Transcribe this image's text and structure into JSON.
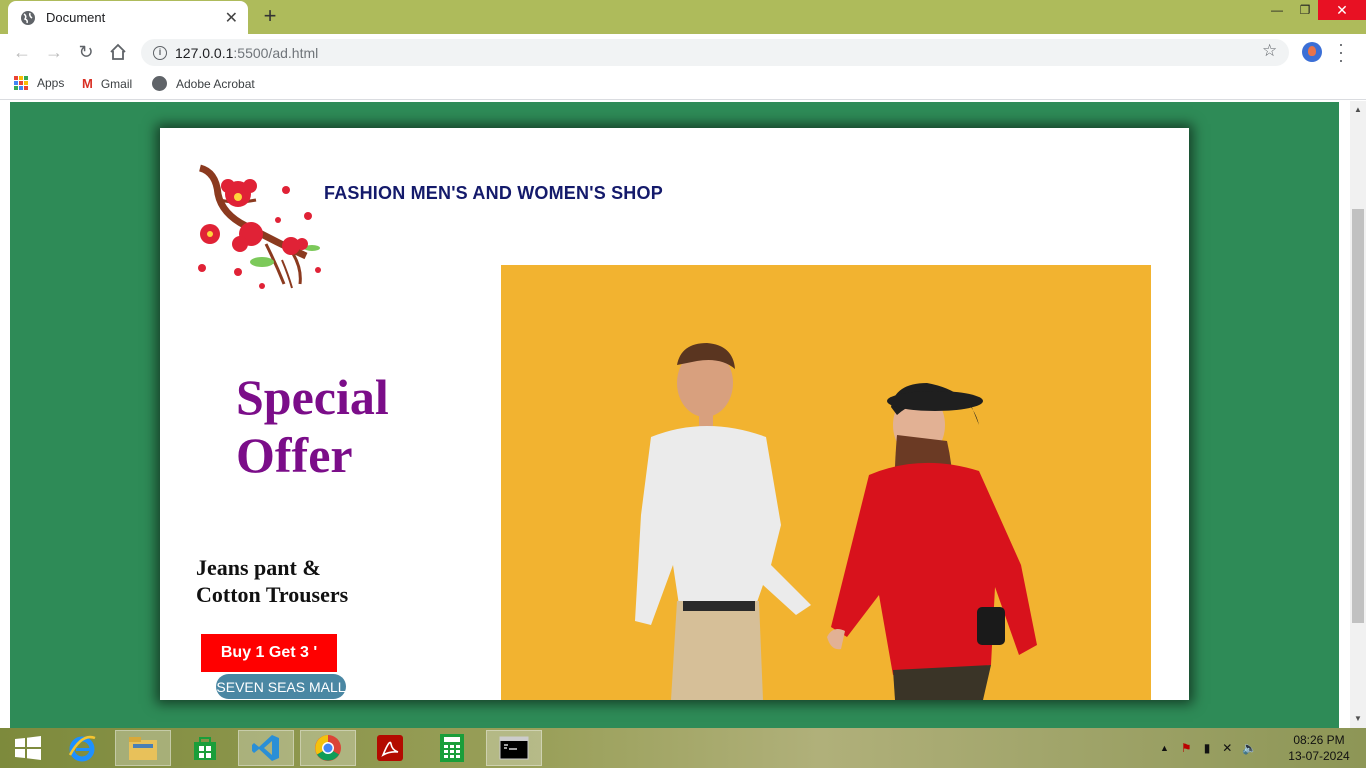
{
  "browser": {
    "tab_title": "Document",
    "url_host": "127.0.0.1",
    "url_path": ":5500/ad.html",
    "bookmarks": [
      {
        "label": "Apps"
      },
      {
        "label": "Gmail"
      },
      {
        "label": "Adobe Acrobat"
      }
    ]
  },
  "ad": {
    "shop_title": "FASHION MEN'S AND WOMEN'S SHOP",
    "offer_line1": "Special",
    "offer_line2": "Offer",
    "product_line1": "Jeans pant &",
    "product_line2": "Cotton Trousers",
    "buy_button": "Buy 1 Get 3 '",
    "mall_button": "SEVEN SEAS MALL",
    "colors": {
      "page_background": "#2e8b57",
      "title": "#141a6b",
      "offer": "#7b0d89",
      "buy_button": "#ff0000",
      "mall_button": "#4a87a3",
      "photo_background": "#f0b02c"
    }
  },
  "taskbar": {
    "time": "08:26 PM",
    "date": "13-07-2024",
    "apps": [
      "start-icon",
      "internet-explorer-icon",
      "file-explorer-icon",
      "store-icon",
      "vscode-icon",
      "chrome-icon",
      "acrobat-icon",
      "calculator-icon",
      "command-prompt-icon"
    ]
  }
}
